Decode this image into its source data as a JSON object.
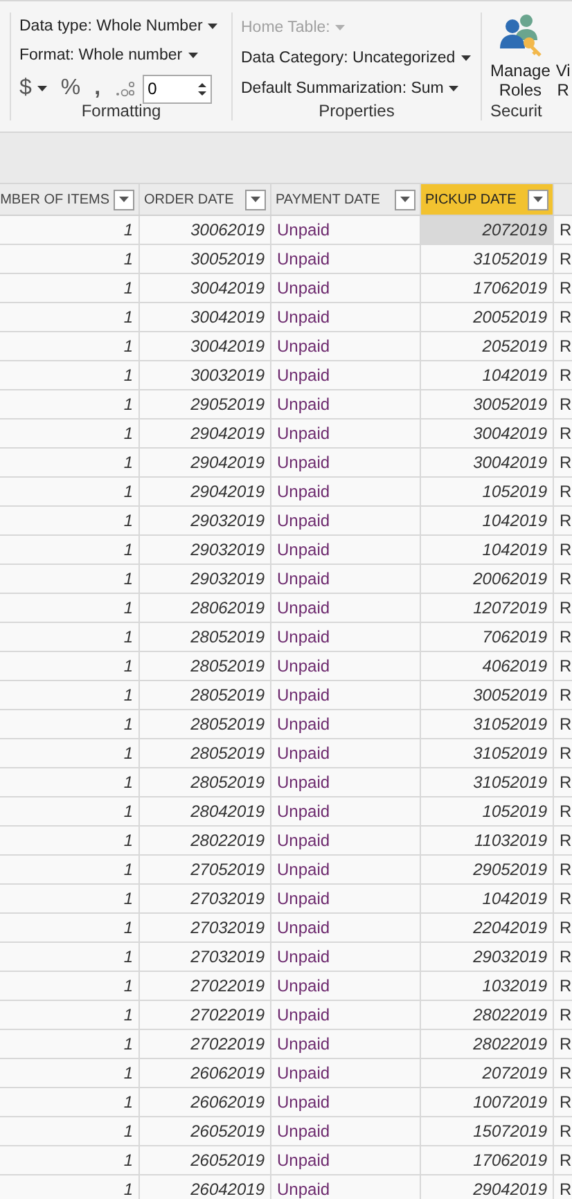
{
  "ribbon": {
    "formatting": {
      "data_type": "Data type: Whole Number",
      "format": "Format: Whole number",
      "currency": "$",
      "percent": "%",
      "comma": ",",
      "decimal_places": "0",
      "label": "Formatting"
    },
    "properties": {
      "home_table": "Home Table:",
      "home_table_disabled": true,
      "data_category": "Data Category: Uncategorized",
      "default_summarization": "Default Summarization: Sum",
      "label": "Properties"
    },
    "security": {
      "buttons": [
        {
          "lines": [
            "Manage",
            "Roles"
          ]
        },
        {
          "lines": [
            "Vi",
            "R"
          ]
        }
      ],
      "label": "Securit"
    }
  },
  "table": {
    "columns": [
      {
        "label": "MBER OF ITEMS",
        "kind": "number",
        "selected": false
      },
      {
        "label": "ORDER DATE",
        "kind": "number",
        "selected": false
      },
      {
        "label": "PAYMENT DATE",
        "kind": "text",
        "selected": false
      },
      {
        "label": "PICKUP DATE",
        "kind": "number",
        "selected": true
      },
      {
        "kind": "text",
        "selected": false
      }
    ],
    "rows": [
      {
        "cells": [
          "1",
          "30062019",
          "Unpaid",
          "2072019",
          "R"
        ],
        "highlighted": true
      },
      {
        "cells": [
          "1",
          "30052019",
          "Unpaid",
          "31052019",
          "R"
        ],
        "highlighted": false
      },
      {
        "cells": [
          "1",
          "30042019",
          "Unpaid",
          "17062019",
          "R"
        ],
        "highlighted": false
      },
      {
        "cells": [
          "1",
          "30042019",
          "Unpaid",
          "20052019",
          "R"
        ],
        "highlighted": false
      },
      {
        "cells": [
          "1",
          "30042019",
          "Unpaid",
          "2052019",
          "R"
        ],
        "highlighted": false
      },
      {
        "cells": [
          "1",
          "30032019",
          "Unpaid",
          "1042019",
          "R"
        ],
        "highlighted": false
      },
      {
        "cells": [
          "1",
          "29052019",
          "Unpaid",
          "30052019",
          "R"
        ],
        "highlighted": false
      },
      {
        "cells": [
          "1",
          "29042019",
          "Unpaid",
          "30042019",
          "R"
        ],
        "highlighted": false
      },
      {
        "cells": [
          "1",
          "29042019",
          "Unpaid",
          "30042019",
          "R"
        ],
        "highlighted": false
      },
      {
        "cells": [
          "1",
          "29042019",
          "Unpaid",
          "1052019",
          "R"
        ],
        "highlighted": false
      },
      {
        "cells": [
          "1",
          "29032019",
          "Unpaid",
          "1042019",
          "R"
        ],
        "highlighted": false
      },
      {
        "cells": [
          "1",
          "29032019",
          "Unpaid",
          "1042019",
          "R"
        ],
        "highlighted": false
      },
      {
        "cells": [
          "1",
          "29032019",
          "Unpaid",
          "20062019",
          "R"
        ],
        "highlighted": false
      },
      {
        "cells": [
          "1",
          "28062019",
          "Unpaid",
          "12072019",
          "R"
        ],
        "highlighted": false
      },
      {
        "cells": [
          "1",
          "28052019",
          "Unpaid",
          "7062019",
          "R"
        ],
        "highlighted": false
      },
      {
        "cells": [
          "1",
          "28052019",
          "Unpaid",
          "4062019",
          "R"
        ],
        "highlighted": false
      },
      {
        "cells": [
          "1",
          "28052019",
          "Unpaid",
          "30052019",
          "R"
        ],
        "highlighted": false
      },
      {
        "cells": [
          "1",
          "28052019",
          "Unpaid",
          "31052019",
          "R"
        ],
        "highlighted": false
      },
      {
        "cells": [
          "1",
          "28052019",
          "Unpaid",
          "31052019",
          "R"
        ],
        "highlighted": false
      },
      {
        "cells": [
          "1",
          "28052019",
          "Unpaid",
          "31052019",
          "R"
        ],
        "highlighted": false
      },
      {
        "cells": [
          "1",
          "28042019",
          "Unpaid",
          "1052019",
          "R"
        ],
        "highlighted": false
      },
      {
        "cells": [
          "1",
          "28022019",
          "Unpaid",
          "11032019",
          "R"
        ],
        "highlighted": false
      },
      {
        "cells": [
          "1",
          "27052019",
          "Unpaid",
          "29052019",
          "R"
        ],
        "highlighted": false
      },
      {
        "cells": [
          "1",
          "27032019",
          "Unpaid",
          "1042019",
          "R"
        ],
        "highlighted": false
      },
      {
        "cells": [
          "1",
          "27032019",
          "Unpaid",
          "22042019",
          "R"
        ],
        "highlighted": false
      },
      {
        "cells": [
          "1",
          "27032019",
          "Unpaid",
          "29032019",
          "R"
        ],
        "highlighted": false
      },
      {
        "cells": [
          "1",
          "27022019",
          "Unpaid",
          "1032019",
          "R"
        ],
        "highlighted": false
      },
      {
        "cells": [
          "1",
          "27022019",
          "Unpaid",
          "28022019",
          "R"
        ],
        "highlighted": false
      },
      {
        "cells": [
          "1",
          "27022019",
          "Unpaid",
          "28022019",
          "R"
        ],
        "highlighted": false
      },
      {
        "cells": [
          "1",
          "26062019",
          "Unpaid",
          "2072019",
          "R"
        ],
        "highlighted": false
      },
      {
        "cells": [
          "1",
          "26062019",
          "Unpaid",
          "10072019",
          "R"
        ],
        "highlighted": false
      },
      {
        "cells": [
          "1",
          "26052019",
          "Unpaid",
          "15072019",
          "R"
        ],
        "highlighted": false
      },
      {
        "cells": [
          "1",
          "26052019",
          "Unpaid",
          "17062019",
          "R"
        ],
        "highlighted": false
      },
      {
        "cells": [
          "1",
          "26042019",
          "Unpaid",
          "29042019",
          "R"
        ],
        "highlighted": false
      }
    ]
  }
}
